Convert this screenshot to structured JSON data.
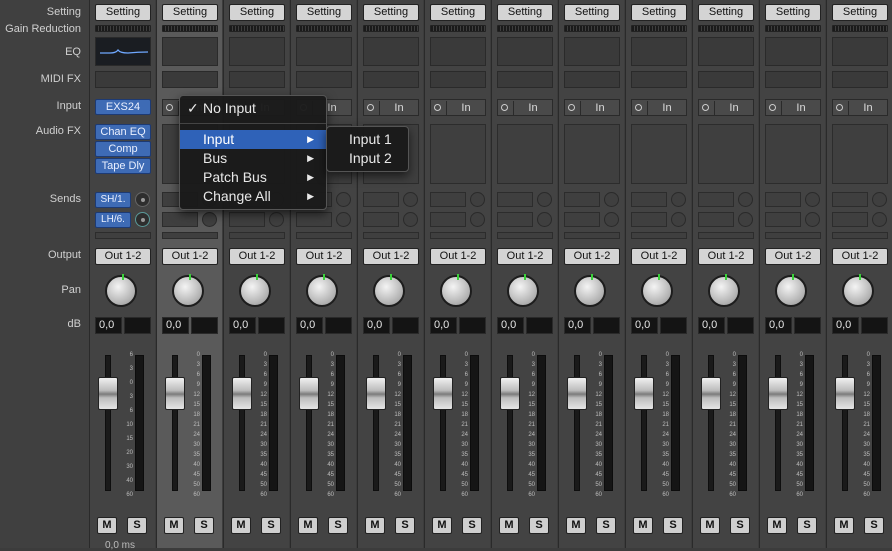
{
  "row_labels": {
    "setting": "Setting",
    "gain_reduction": "Gain Reduction",
    "eq": "EQ",
    "midi_fx": "MIDI FX",
    "input": "Input",
    "audio_fx": "Audio FX",
    "sends": "Sends",
    "output": "Output",
    "pan": "Pan",
    "db": "dB"
  },
  "strip_setting_label": "Setting",
  "strip_input_label": "In",
  "strip_output_label": "Out 1-2",
  "strip_db_value": "0,0",
  "mute_label": "M",
  "solo_label": "S",
  "first_strip": {
    "input_plugin": "EXS24",
    "audio_fx": [
      "Chan EQ",
      "Comp",
      "Tape Dly"
    ],
    "sends": [
      "SH/1.",
      "LH/6."
    ]
  },
  "fader_scale_first": [
    "6",
    "3",
    "0",
    "3",
    "6",
    "10",
    "15",
    "20",
    "30",
    "40",
    "60"
  ],
  "fader_scale": [
    "0",
    "3",
    "6",
    "9",
    "12",
    "15",
    "18",
    "21",
    "24",
    "30",
    "35",
    "40",
    "45",
    "50",
    "60"
  ],
  "footer_time": "0,0 ms",
  "input_menu": {
    "checked_item": "No Input",
    "items": [
      {
        "label": "Input",
        "has_submenu": true,
        "highlighted": true
      },
      {
        "label": "Bus",
        "has_submenu": true,
        "highlighted": false
      },
      {
        "label": "Patch Bus",
        "has_submenu": true,
        "highlighted": false
      },
      {
        "label": "Change All",
        "has_submenu": true,
        "highlighted": false
      }
    ]
  },
  "input_submenu": {
    "items": [
      "Input 1",
      "Input 2"
    ]
  },
  "colors": {
    "accent_blue": "#3e6bb5",
    "menu_highlight": "#2f62b8",
    "pan_indicator": "#3ad13a",
    "background": "#3c3c3c"
  }
}
